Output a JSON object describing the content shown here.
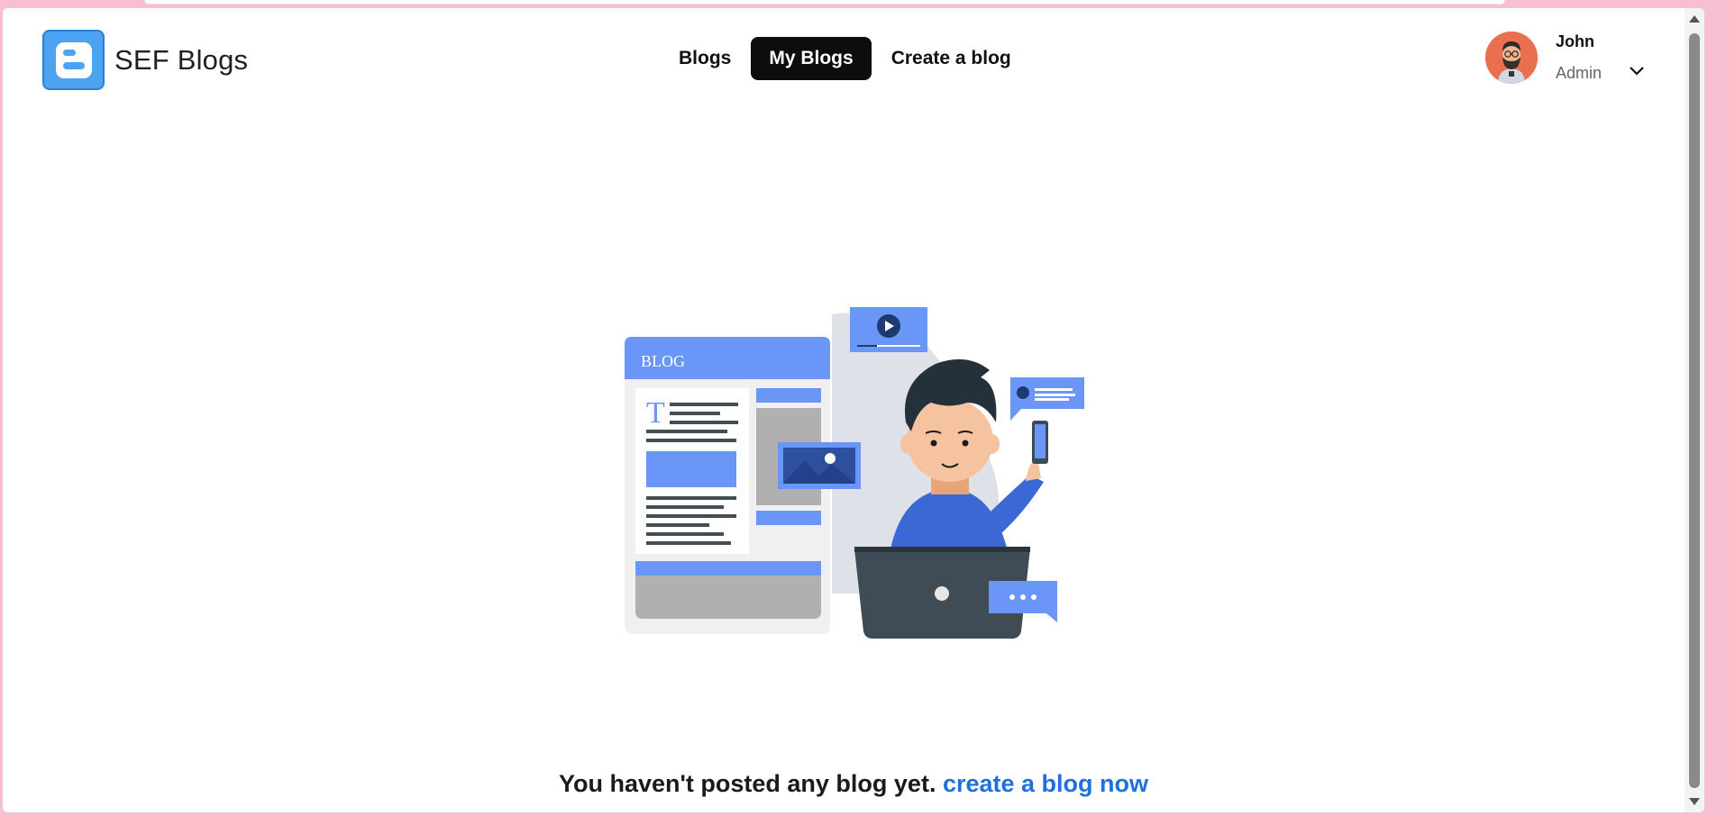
{
  "brand": {
    "name": "SEF Blogs",
    "icon": "blogger-logo-icon"
  },
  "nav": {
    "links": [
      {
        "label": "Blogs",
        "active": false
      },
      {
        "label": "My Blogs",
        "active": true
      },
      {
        "label": "Create a blog",
        "active": false
      }
    ]
  },
  "user": {
    "name": "John",
    "role": "Admin",
    "avatar": "bearded-man-avatar"
  },
  "illustration": {
    "blog_label": "BLOG"
  },
  "empty_state": {
    "message": "You haven't posted any blog yet.",
    "link": "create a blog now"
  },
  "colors": {
    "accent": "#6a97f7",
    "link": "#1f6fe0",
    "active_nav_bg": "#0d0d0d"
  }
}
